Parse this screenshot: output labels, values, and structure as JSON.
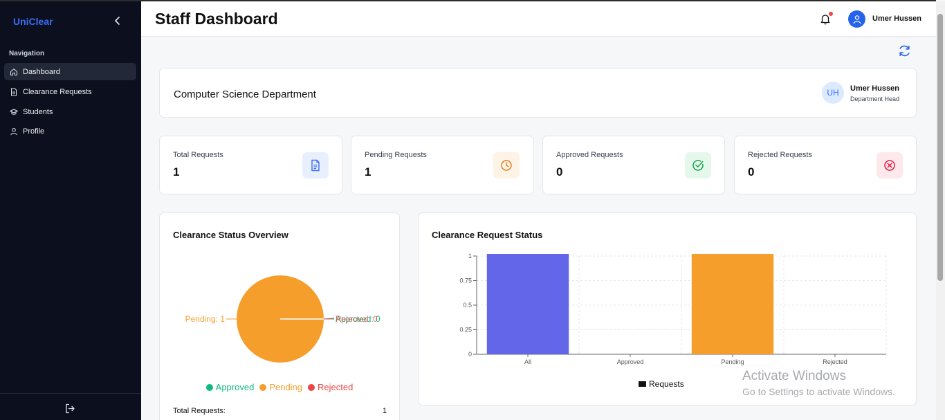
{
  "sidebar": {
    "brand": "UniClear",
    "nav_title": "Navigation",
    "items": [
      {
        "label": "Dashboard",
        "icon": "home-icon",
        "active": true
      },
      {
        "label": "Clearance Requests",
        "icon": "document-icon"
      },
      {
        "label": "Students",
        "icon": "graduation-cap-icon"
      },
      {
        "label": "Profile",
        "icon": "user-icon"
      }
    ],
    "logout_icon": "logout-icon"
  },
  "header": {
    "title": "Staff Dashboard",
    "user_name": "Umer Hussen",
    "icons": [
      "bell-icon",
      "user-avatar-icon"
    ]
  },
  "department": {
    "name": "Computer Science Department",
    "initials": "UH",
    "head_name": "Umer Hussen",
    "head_role": "Department Head"
  },
  "stats": [
    {
      "label": "Total Requests",
      "value": "1",
      "icon": "document-icon",
      "color": "#3b6cf6",
      "bg": "#e8effd"
    },
    {
      "label": "Pending Requests",
      "value": "1",
      "icon": "clock-icon",
      "color": "#e0821c",
      "bg": "#fdf3e6"
    },
    {
      "label": "Approved Requests",
      "value": "0",
      "icon": "check-circle-icon",
      "color": "#16a34a",
      "bg": "#e6f7ec"
    },
    {
      "label": "Rejected Requests",
      "value": "0",
      "icon": "x-circle-icon",
      "color": "#e11d48",
      "bg": "#fde9ec"
    }
  ],
  "pie_card": {
    "title": "Clearance Status Overview",
    "labels": {
      "pending": "Pending: 1",
      "rejected": "Rejected: 0",
      "approved": "Approved: 0"
    },
    "legend": [
      {
        "label": "Approved",
        "color": "#10b981"
      },
      {
        "label": "Pending",
        "color": "#f59e2b"
      },
      {
        "label": "Rejected",
        "color": "#ef4444"
      }
    ],
    "total_label": "Total Requests:",
    "total_value": "1"
  },
  "bar_card": {
    "title": "Clearance Request Status",
    "legend_label": "Requests"
  },
  "chart_data": [
    {
      "type": "pie",
      "title": "Clearance Status Overview",
      "categories": [
        "Approved",
        "Pending",
        "Rejected"
      ],
      "values": [
        0,
        1,
        0
      ],
      "colors": [
        "#10b981",
        "#f59e2b",
        "#ef4444"
      ],
      "legend": "bottom"
    },
    {
      "type": "bar",
      "title": "Clearance Request Status",
      "categories": [
        "All",
        "Approved",
        "Pending",
        "Rejected"
      ],
      "series": [
        {
          "name": "Requests",
          "values": [
            1,
            0,
            1,
            0
          ]
        }
      ],
      "colors": [
        "#6366e8",
        "#10b981",
        "#f59e2b",
        "#ef4444"
      ],
      "yticks": [
        "0",
        "0.25",
        "0.5",
        "0.75",
        "1"
      ],
      "ylim": [
        0,
        1
      ],
      "grid": true,
      "legend": "bottom"
    }
  ],
  "watermark": {
    "line1": "Activate Windows",
    "line2": "Go to Settings to activate Windows."
  }
}
